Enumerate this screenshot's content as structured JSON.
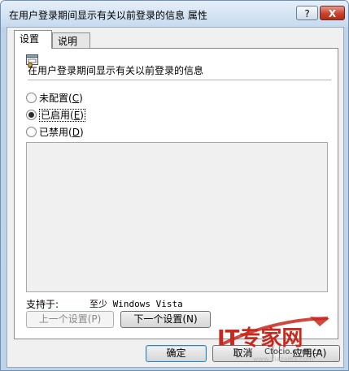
{
  "window": {
    "title": "在用户登录期间显示有关以前登录的信息 属性",
    "help_label": "?",
    "close_label": "X"
  },
  "tabs": [
    {
      "label": "设置",
      "active": true
    },
    {
      "label": "说明",
      "active": false
    }
  ],
  "policy": {
    "title": "在用户登录期间显示有关以前登录的信息",
    "icon": "policy-settings-icon"
  },
  "options": [
    {
      "label": "未配置",
      "key": "C",
      "checked": false
    },
    {
      "label": "已启用",
      "key": "E",
      "checked": true
    },
    {
      "label": "已禁用",
      "key": "D",
      "checked": false
    }
  ],
  "support": {
    "label": "支持于:",
    "value": "至少 Windows Vista"
  },
  "nav": {
    "prev_label": "上一个设置(P)",
    "next_label": "下一个设置(N)"
  },
  "buttons": {
    "ok": "确定",
    "cancel": "取消",
    "apply": "应用(A)"
  },
  "watermark": {
    "brand": "IT专家网",
    "url": "Ctocio.com.cn",
    "faint": "www.xiazaiba.com"
  }
}
